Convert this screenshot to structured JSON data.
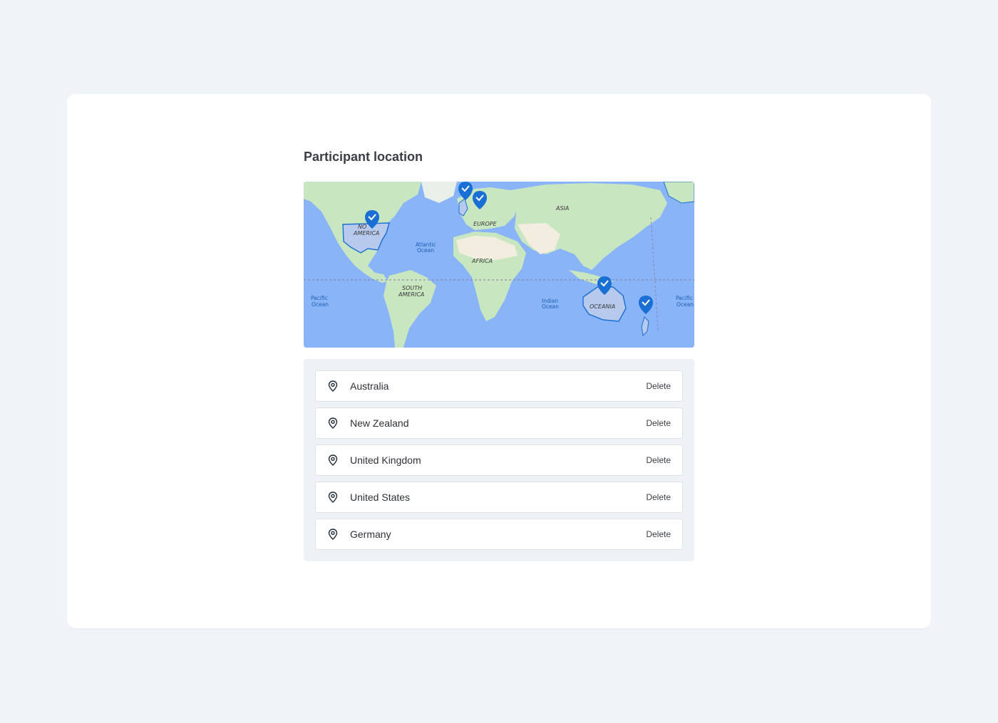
{
  "section": {
    "title": "Participant location"
  },
  "map": {
    "labels": {
      "asia": "ASIA",
      "europe": "EUROPE",
      "north_america_1": "NO",
      "north_america_2": "AMERICA",
      "africa": "AFRICA",
      "south_america_1": "SOUTH",
      "south_america_2": "AMERICA",
      "oceania": "OCEANIA",
      "atlantic_1": "Atlantic",
      "atlantic_2": "Ocean",
      "pacific_w_1": "Pacific",
      "pacific_w_2": "Ocean",
      "pacific_e_1": "Pacific",
      "pacific_e_2": "Ocean",
      "indian_1": "Indian",
      "indian_2": "Ocean"
    },
    "colors": {
      "water": "#8ab4f8",
      "land": "#c8e6c0",
      "marker": "#1a6fd4",
      "highlight": "#b7c9ec"
    },
    "markers": [
      "United States",
      "United Kingdom",
      "Germany",
      "Australia",
      "New Zealand"
    ]
  },
  "locations": [
    {
      "name": "Australia",
      "action": "Delete"
    },
    {
      "name": "New Zealand",
      "action": "Delete"
    },
    {
      "name": "United Kingdom",
      "action": "Delete"
    },
    {
      "name": "United States",
      "action": "Delete"
    },
    {
      "name": "Germany",
      "action": "Delete"
    }
  ]
}
